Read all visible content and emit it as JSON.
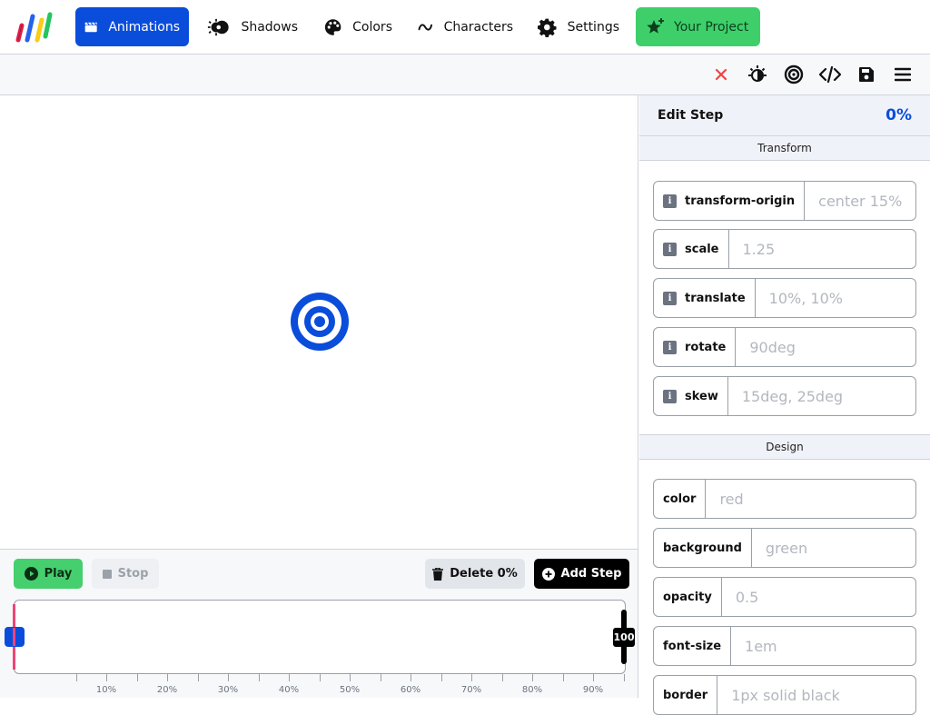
{
  "nav": {
    "items": [
      {
        "label": "Animations",
        "icon": "clapperboard-icon",
        "active": true
      },
      {
        "label": "Shadows",
        "icon": "eclipse-icon"
      },
      {
        "label": "Colors",
        "icon": "palette-icon"
      },
      {
        "label": "Characters",
        "icon": "tilde-icon"
      },
      {
        "label": "Settings",
        "icon": "gear-icon"
      }
    ],
    "project_label": "Your Project"
  },
  "toolbar": {
    "icons": [
      "close-icon",
      "theme-toggle-icon",
      "target-icon",
      "code-icon",
      "save-icon",
      "menu-icon"
    ]
  },
  "controls": {
    "play_label": "Play",
    "stop_label": "Stop",
    "delete_label": "Delete 0%",
    "add_label": "Add Step"
  },
  "timeline": {
    "end_marker": "100",
    "current_step_percent": 0,
    "ticks": [
      "10%",
      "20%",
      "30%",
      "40%",
      "50%",
      "60%",
      "70%",
      "80%",
      "90%"
    ]
  },
  "panel": {
    "title": "Edit Step",
    "percent": "0%",
    "transform_section": "Transform",
    "design_section": "Design",
    "transform_fields": [
      {
        "label": "transform-origin",
        "placeholder": "center 15%"
      },
      {
        "label": "scale",
        "placeholder": "1.25"
      },
      {
        "label": "translate",
        "placeholder": "10%, 10%"
      },
      {
        "label": "rotate",
        "placeholder": "90deg"
      },
      {
        "label": "skew",
        "placeholder": "15deg, 25deg"
      }
    ],
    "design_fields": [
      {
        "label": "color",
        "placeholder": "red"
      },
      {
        "label": "background",
        "placeholder": "green"
      },
      {
        "label": "opacity",
        "placeholder": "0.5"
      },
      {
        "label": "font-size",
        "placeholder": "1em"
      },
      {
        "label": "border",
        "placeholder": "1px solid black"
      }
    ]
  },
  "colors": {
    "accent": "#0a4ddb",
    "success": "#45cf6e",
    "danger": "#ef4444"
  }
}
